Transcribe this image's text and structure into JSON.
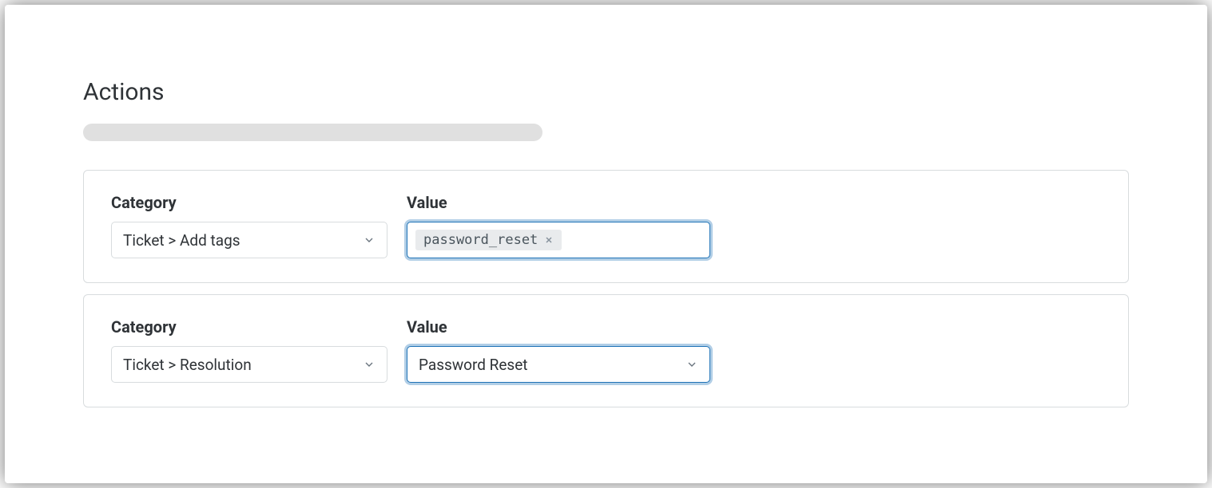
{
  "section": {
    "title": "Actions"
  },
  "actions": [
    {
      "category_label": "Category",
      "category_value": "Ticket > Add tags",
      "value_label": "Value",
      "value_type": "tags",
      "tags": [
        "password_reset"
      ]
    },
    {
      "category_label": "Category",
      "category_value": "Ticket > Resolution",
      "value_label": "Value",
      "value_type": "select",
      "value_selected": "Password Reset"
    }
  ]
}
